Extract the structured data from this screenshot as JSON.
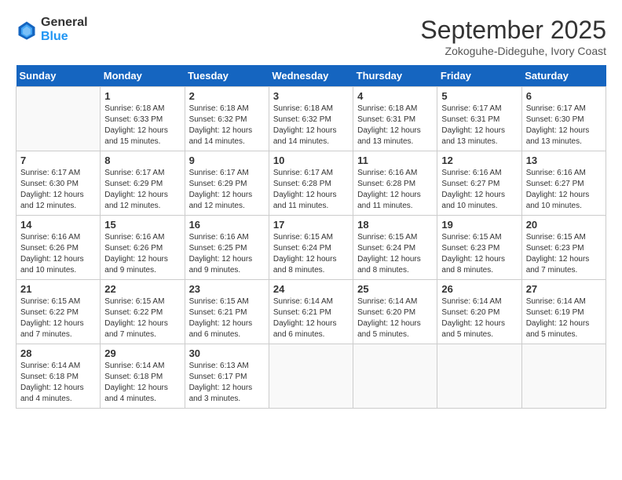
{
  "header": {
    "logo_general": "General",
    "logo_blue": "Blue",
    "title": "September 2025",
    "location": "Zokoguhe-Dideguhe, Ivory Coast"
  },
  "days_of_week": [
    "Sunday",
    "Monday",
    "Tuesday",
    "Wednesday",
    "Thursday",
    "Friday",
    "Saturday"
  ],
  "weeks": [
    [
      {
        "day": "",
        "info": ""
      },
      {
        "day": "1",
        "info": "Sunrise: 6:18 AM\nSunset: 6:33 PM\nDaylight: 12 hours\nand 15 minutes."
      },
      {
        "day": "2",
        "info": "Sunrise: 6:18 AM\nSunset: 6:32 PM\nDaylight: 12 hours\nand 14 minutes."
      },
      {
        "day": "3",
        "info": "Sunrise: 6:18 AM\nSunset: 6:32 PM\nDaylight: 12 hours\nand 14 minutes."
      },
      {
        "day": "4",
        "info": "Sunrise: 6:18 AM\nSunset: 6:31 PM\nDaylight: 12 hours\nand 13 minutes."
      },
      {
        "day": "5",
        "info": "Sunrise: 6:17 AM\nSunset: 6:31 PM\nDaylight: 12 hours\nand 13 minutes."
      },
      {
        "day": "6",
        "info": "Sunrise: 6:17 AM\nSunset: 6:30 PM\nDaylight: 12 hours\nand 13 minutes."
      }
    ],
    [
      {
        "day": "7",
        "info": "Sunrise: 6:17 AM\nSunset: 6:30 PM\nDaylight: 12 hours\nand 12 minutes."
      },
      {
        "day": "8",
        "info": "Sunrise: 6:17 AM\nSunset: 6:29 PM\nDaylight: 12 hours\nand 12 minutes."
      },
      {
        "day": "9",
        "info": "Sunrise: 6:17 AM\nSunset: 6:29 PM\nDaylight: 12 hours\nand 12 minutes."
      },
      {
        "day": "10",
        "info": "Sunrise: 6:17 AM\nSunset: 6:28 PM\nDaylight: 12 hours\nand 11 minutes."
      },
      {
        "day": "11",
        "info": "Sunrise: 6:16 AM\nSunset: 6:28 PM\nDaylight: 12 hours\nand 11 minutes."
      },
      {
        "day": "12",
        "info": "Sunrise: 6:16 AM\nSunset: 6:27 PM\nDaylight: 12 hours\nand 10 minutes."
      },
      {
        "day": "13",
        "info": "Sunrise: 6:16 AM\nSunset: 6:27 PM\nDaylight: 12 hours\nand 10 minutes."
      }
    ],
    [
      {
        "day": "14",
        "info": "Sunrise: 6:16 AM\nSunset: 6:26 PM\nDaylight: 12 hours\nand 10 minutes."
      },
      {
        "day": "15",
        "info": "Sunrise: 6:16 AM\nSunset: 6:26 PM\nDaylight: 12 hours\nand 9 minutes."
      },
      {
        "day": "16",
        "info": "Sunrise: 6:16 AM\nSunset: 6:25 PM\nDaylight: 12 hours\nand 9 minutes."
      },
      {
        "day": "17",
        "info": "Sunrise: 6:15 AM\nSunset: 6:24 PM\nDaylight: 12 hours\nand 8 minutes."
      },
      {
        "day": "18",
        "info": "Sunrise: 6:15 AM\nSunset: 6:24 PM\nDaylight: 12 hours\nand 8 minutes."
      },
      {
        "day": "19",
        "info": "Sunrise: 6:15 AM\nSunset: 6:23 PM\nDaylight: 12 hours\nand 8 minutes."
      },
      {
        "day": "20",
        "info": "Sunrise: 6:15 AM\nSunset: 6:23 PM\nDaylight: 12 hours\nand 7 minutes."
      }
    ],
    [
      {
        "day": "21",
        "info": "Sunrise: 6:15 AM\nSunset: 6:22 PM\nDaylight: 12 hours\nand 7 minutes."
      },
      {
        "day": "22",
        "info": "Sunrise: 6:15 AM\nSunset: 6:22 PM\nDaylight: 12 hours\nand 7 minutes."
      },
      {
        "day": "23",
        "info": "Sunrise: 6:15 AM\nSunset: 6:21 PM\nDaylight: 12 hours\nand 6 minutes."
      },
      {
        "day": "24",
        "info": "Sunrise: 6:14 AM\nSunset: 6:21 PM\nDaylight: 12 hours\nand 6 minutes."
      },
      {
        "day": "25",
        "info": "Sunrise: 6:14 AM\nSunset: 6:20 PM\nDaylight: 12 hours\nand 5 minutes."
      },
      {
        "day": "26",
        "info": "Sunrise: 6:14 AM\nSunset: 6:20 PM\nDaylight: 12 hours\nand 5 minutes."
      },
      {
        "day": "27",
        "info": "Sunrise: 6:14 AM\nSunset: 6:19 PM\nDaylight: 12 hours\nand 5 minutes."
      }
    ],
    [
      {
        "day": "28",
        "info": "Sunrise: 6:14 AM\nSunset: 6:18 PM\nDaylight: 12 hours\nand 4 minutes."
      },
      {
        "day": "29",
        "info": "Sunrise: 6:14 AM\nSunset: 6:18 PM\nDaylight: 12 hours\nand 4 minutes."
      },
      {
        "day": "30",
        "info": "Sunrise: 6:13 AM\nSunset: 6:17 PM\nDaylight: 12 hours\nand 3 minutes."
      },
      {
        "day": "",
        "info": ""
      },
      {
        "day": "",
        "info": ""
      },
      {
        "day": "",
        "info": ""
      },
      {
        "day": "",
        "info": ""
      }
    ]
  ]
}
